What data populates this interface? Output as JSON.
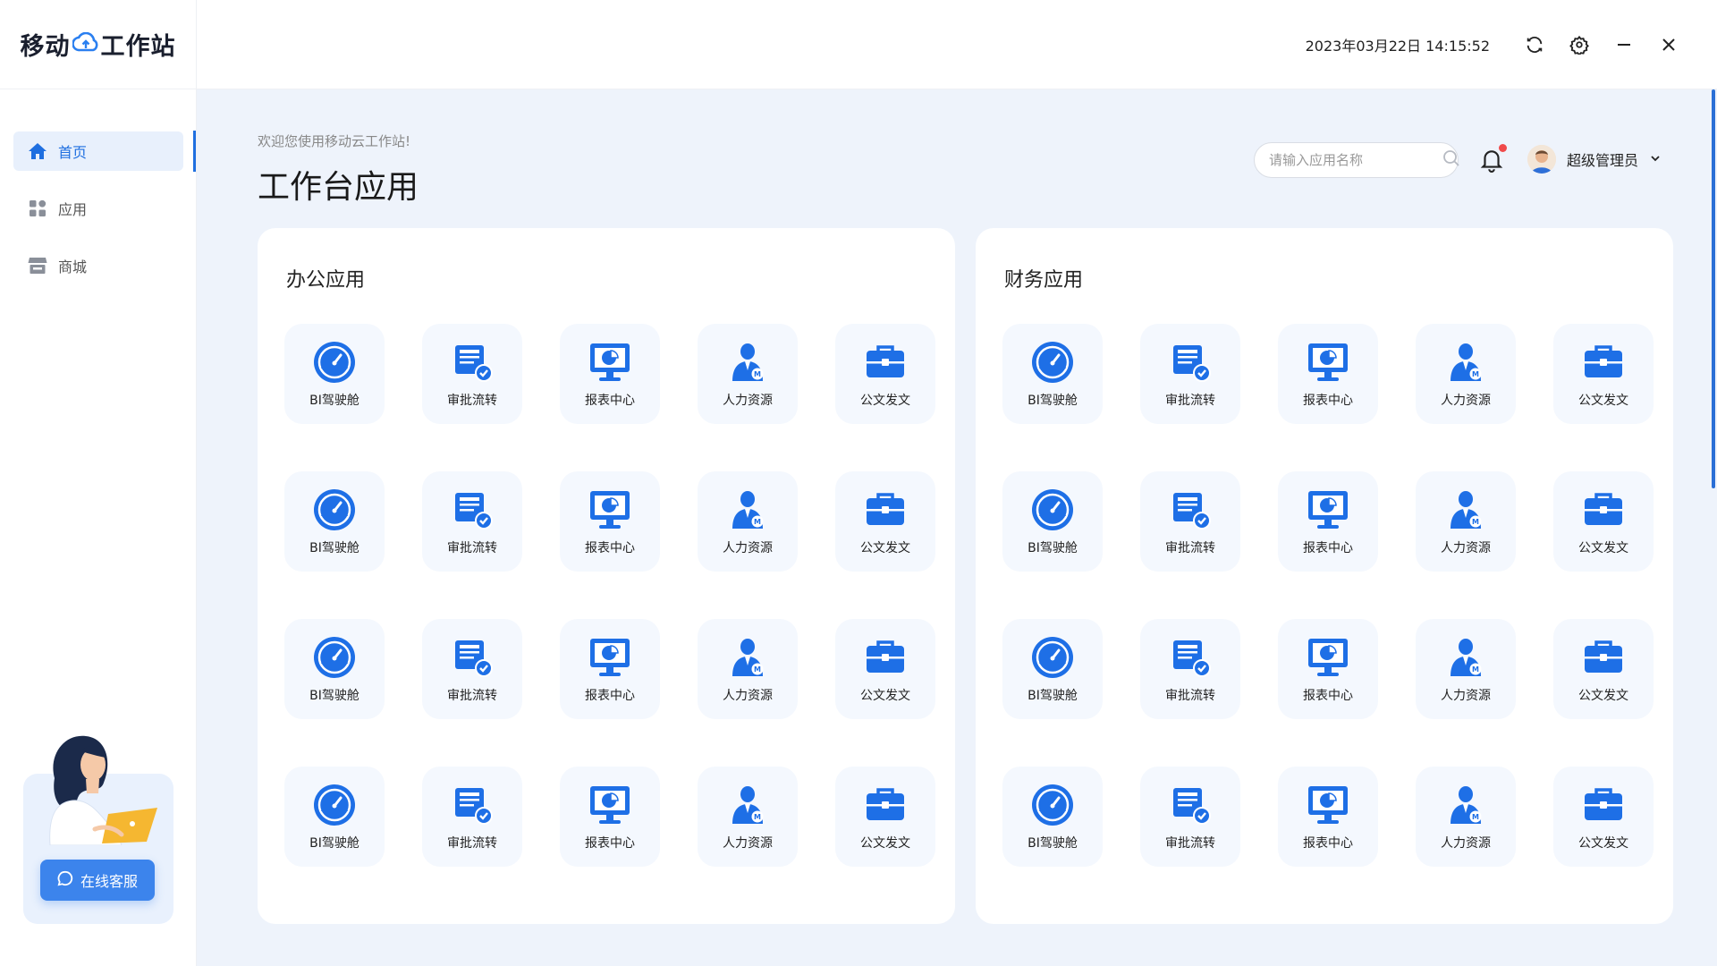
{
  "app": {
    "logo_left": "移动",
    "logo_right": "工作站",
    "datetime": "2023年03月22日 14:15:52"
  },
  "sidebar": {
    "items": [
      {
        "label": "首页",
        "icon": "home-icon",
        "active": true
      },
      {
        "label": "应用",
        "icon": "apps-grid-icon",
        "active": false
      },
      {
        "label": "商城",
        "icon": "store-icon",
        "active": false
      }
    ],
    "support_label": "在线客服"
  },
  "main": {
    "welcome": "欢迎您使用移动云工作站!",
    "title": "工作台应用",
    "search_placeholder": "请输入应用名称",
    "user_name": "超级管理员"
  },
  "sections": [
    {
      "title": "办公应用",
      "apps": [
        "BI驾驶舱",
        "审批流转",
        "报表中心",
        "人力资源",
        "公文发文",
        "BI驾驶舱",
        "审批流转",
        "报表中心",
        "人力资源",
        "公文发文",
        "BI驾驶舱",
        "审批流转",
        "报表中心",
        "人力资源",
        "公文发文",
        "BI驾驶舱",
        "审批流转",
        "报表中心",
        "人力资源",
        "公文发文"
      ]
    },
    {
      "title": "财务应用",
      "apps": [
        "BI驾驶舱",
        "审批流转",
        "报表中心",
        "人力资源",
        "公文发文",
        "BI驾驶舱",
        "审批流转",
        "报表中心",
        "人力资源",
        "公文发文",
        "BI驾驶舱",
        "审批流转",
        "报表中心",
        "人力资源",
        "公文发文",
        "BI驾驶舱",
        "审批流转",
        "报表中心",
        "人力资源",
        "公文发文"
      ]
    }
  ],
  "app_icons": {
    "BI驾驶舱": "dashboard-gauge-icon",
    "审批流转": "approval-document-icon",
    "报表中心": "report-monitor-icon",
    "人力资源": "hr-person-icon",
    "公文发文": "briefcase-icon"
  },
  "colors": {
    "accent": "#1f6fe0",
    "icon_blue": "#1e6fe6",
    "tile_bg": "#f4f8fe",
    "page_bg": "#eef3fb",
    "notification_dot": "#f04a4a"
  }
}
